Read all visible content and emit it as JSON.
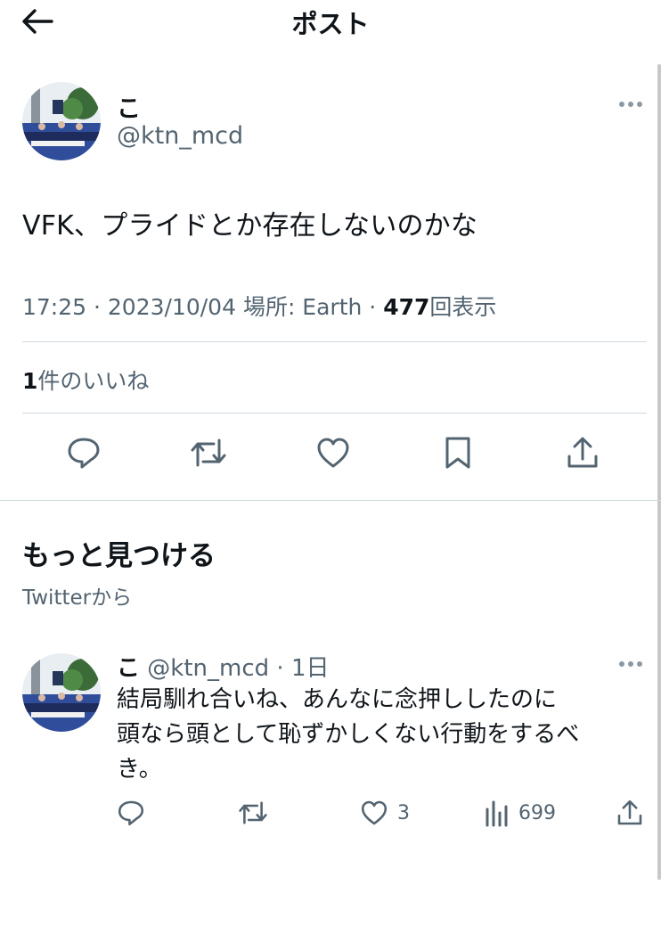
{
  "header": {
    "title": "ポスト",
    "back_icon": "arrow-left-icon"
  },
  "post": {
    "author_name": "こ",
    "author_handle": "@ktn_mcd",
    "text": "VFK、プライドとか存在しないのかな",
    "time": "17:25",
    "date": "2023/10/04",
    "location_label": "場所: Earth",
    "views_count": "477",
    "views_label": "回表示",
    "likes_count": "1",
    "likes_label": "件のいいね",
    "actions": [
      "reply-icon",
      "retweet-icon",
      "like-icon",
      "bookmark-icon",
      "share-icon"
    ]
  },
  "discover": {
    "title": "もっと見つける",
    "subtitle": "Twitterから"
  },
  "reply": {
    "author_name": "こ",
    "author_handle": "@ktn_mcd",
    "age": "1日",
    "lines": [
      "結局馴れ合いね、あんなに念押ししたのに",
      "頭なら頭として恥ずかしくない行動をするべ",
      "き。"
    ],
    "likes": "3",
    "views": "699"
  },
  "colors": {
    "text": "#0f1419",
    "secondary": "#536471",
    "divider": "#cfd9de"
  }
}
